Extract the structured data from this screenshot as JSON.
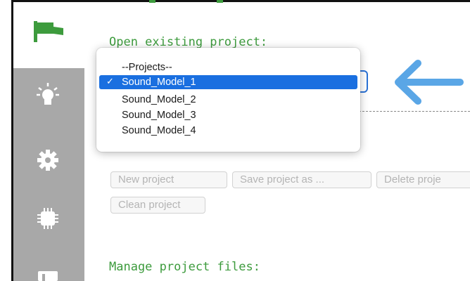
{
  "sidebar": {
    "icons": [
      "flag-icon",
      "lightbulb-icon",
      "gear-icon",
      "chip-icon",
      "panel-icon"
    ],
    "colors": {
      "active_bg": "#ffffff",
      "inactive_bg": "#a8a8a8",
      "flag": "#3d9b3d"
    }
  },
  "headings": {
    "open_existing": "Open existing project:",
    "manage_files": "Manage project files:"
  },
  "project_select": {
    "selected_value": "Sound_Model_1",
    "options": [
      {
        "label": "--Projects--",
        "selected": false
      },
      {
        "label": "Sound_Model_1",
        "selected": true
      },
      {
        "label": "Sound_Model_2",
        "selected": false
      },
      {
        "label": "Sound_Model_3",
        "selected": false
      },
      {
        "label": "Sound_Model_4",
        "selected": false
      }
    ],
    "check_mark": "✓"
  },
  "buttons": {
    "new_project": "New project",
    "save_project_as": "Save project as ...",
    "delete_project": "Delete proje",
    "clean_project": "Clean project"
  },
  "colors": {
    "heading": "#3d9b3d",
    "selection": "#1a6fe0",
    "arrow": "#5aa6e6",
    "focus_ring": "#2a72d6",
    "disabled_text": "#b4b4b4"
  }
}
